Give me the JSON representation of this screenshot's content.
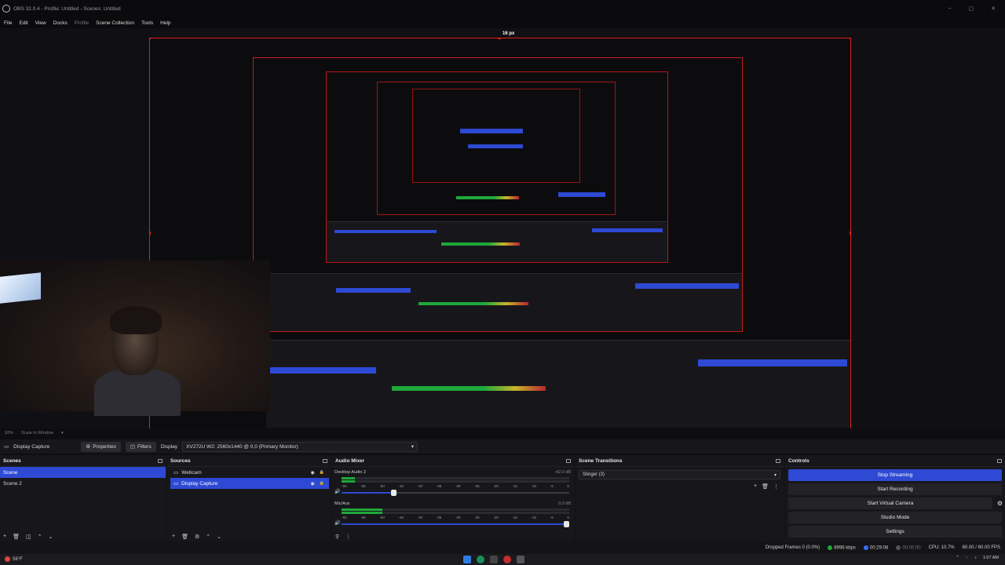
{
  "window": {
    "title": "OBS 32.0.4 - Profile: Untitled - Scenes: Untitled",
    "controls": [
      "–",
      "▢",
      "✕"
    ]
  },
  "menu": {
    "file": "File",
    "edit": "Edit",
    "view": "View",
    "docks": "Docks",
    "profile": "Profile",
    "scene_collection": "Scene Collection",
    "tools": "Tools",
    "help": "Help"
  },
  "preview": {
    "edge_label": "16 px"
  },
  "zoom": {
    "percent": "92%",
    "mode": "Scale to Window"
  },
  "context": {
    "source_name": "Display Capture",
    "properties": "Properties",
    "filters": "Filters",
    "display_label": "Display",
    "display_value": "XV272U W2: 2560x1440 @ 0,0 (Primary Monitor)"
  },
  "scenes": {
    "title": "Scenes",
    "items": [
      {
        "label": "Scene",
        "selected": true
      },
      {
        "label": "Scene 2",
        "selected": false
      }
    ]
  },
  "sources": {
    "title": "Sources",
    "items": [
      {
        "label": "Webcam",
        "selected": false
      },
      {
        "label": "Display Capture",
        "selected": true
      }
    ]
  },
  "mixer": {
    "title": "Audio Mixer",
    "tracks": [
      {
        "name": "Desktop Audio 2",
        "db": "-42.0 dB",
        "level": 0.06,
        "volume": 0.23
      },
      {
        "name": "Mic/Aux",
        "db": "0.0 dB",
        "level": 0.18,
        "volume": 0.99
      }
    ],
    "scale": [
      "-60",
      "-55",
      "-50",
      "-45",
      "-40",
      "-35",
      "-30",
      "-25",
      "-20",
      "-15",
      "-10",
      "-5",
      "0"
    ]
  },
  "transitions": {
    "title": "Scene Transitions",
    "selected": "Stinger (3)"
  },
  "controls": {
    "title": "Controls",
    "stop_streaming": "Stop Streaming",
    "start_recording": "Start Recording",
    "start_virtual_camera": "Start Virtual Camera",
    "studio_mode": "Studio Mode",
    "settings": "Settings"
  },
  "status": {
    "dropped_frames": "Dropped Frames 0 (0.0%)",
    "bitrate": "8996 kbps",
    "stream_time": "00:29:08",
    "record_time": "00:00:00",
    "cpu": "CPU: 10.7%",
    "fps": "60.00 / 60.00 FPS"
  },
  "taskbar": {
    "weather": "56°F",
    "time": "1:07 AM"
  },
  "colors": {
    "accent": "#2e49d3",
    "selection_border": "#e21b1b",
    "meter_green": "#1fa83a",
    "meter_yellow": "#c7b42a",
    "meter_red": "#b8262c"
  }
}
